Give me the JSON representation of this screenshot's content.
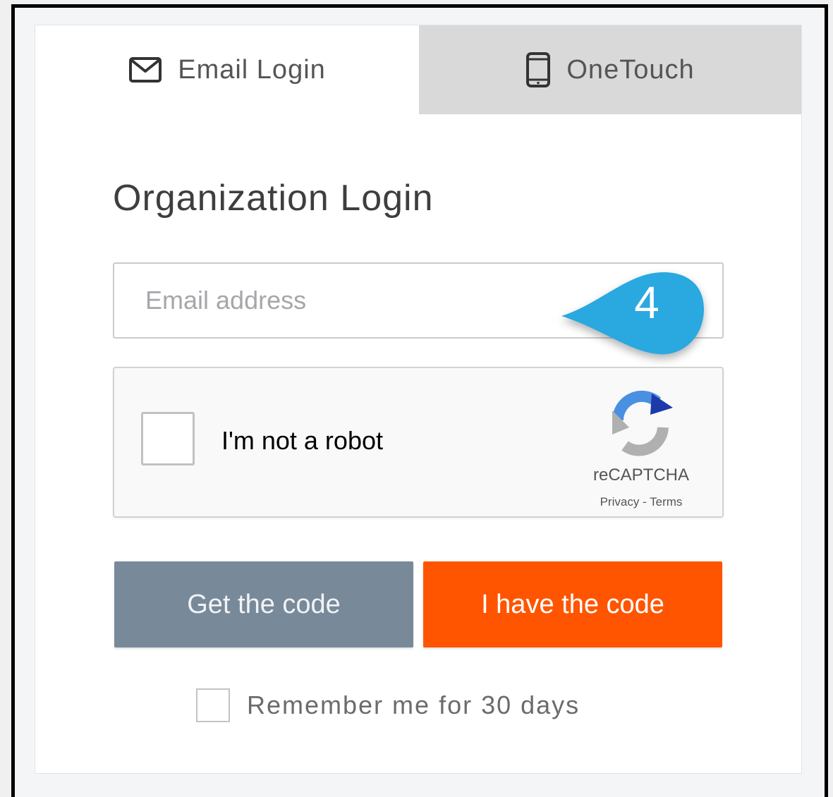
{
  "tabs": {
    "email_label": "Email Login",
    "email_icon": "envelope-icon",
    "onetouch_label": "OneTouch",
    "onetouch_icon": "mobile-phone-icon"
  },
  "form": {
    "heading": "Organization Login",
    "email_placeholder": "Email address",
    "email_value": ""
  },
  "callout": {
    "number": "4",
    "color": "#2aa8e0"
  },
  "recaptcha": {
    "label": "I'm not a robot",
    "brand": "reCAPTCHA",
    "links": "Privacy - Terms",
    "checked": false
  },
  "buttons": {
    "get_code": "Get the code",
    "have_code": "I have the code"
  },
  "remember": {
    "label": "Remember me for 30 days",
    "checked": false
  },
  "colors": {
    "accent_orange": "#ff5500",
    "button_gray": "#78899a",
    "inactive_tab": "#d9d9d9"
  }
}
